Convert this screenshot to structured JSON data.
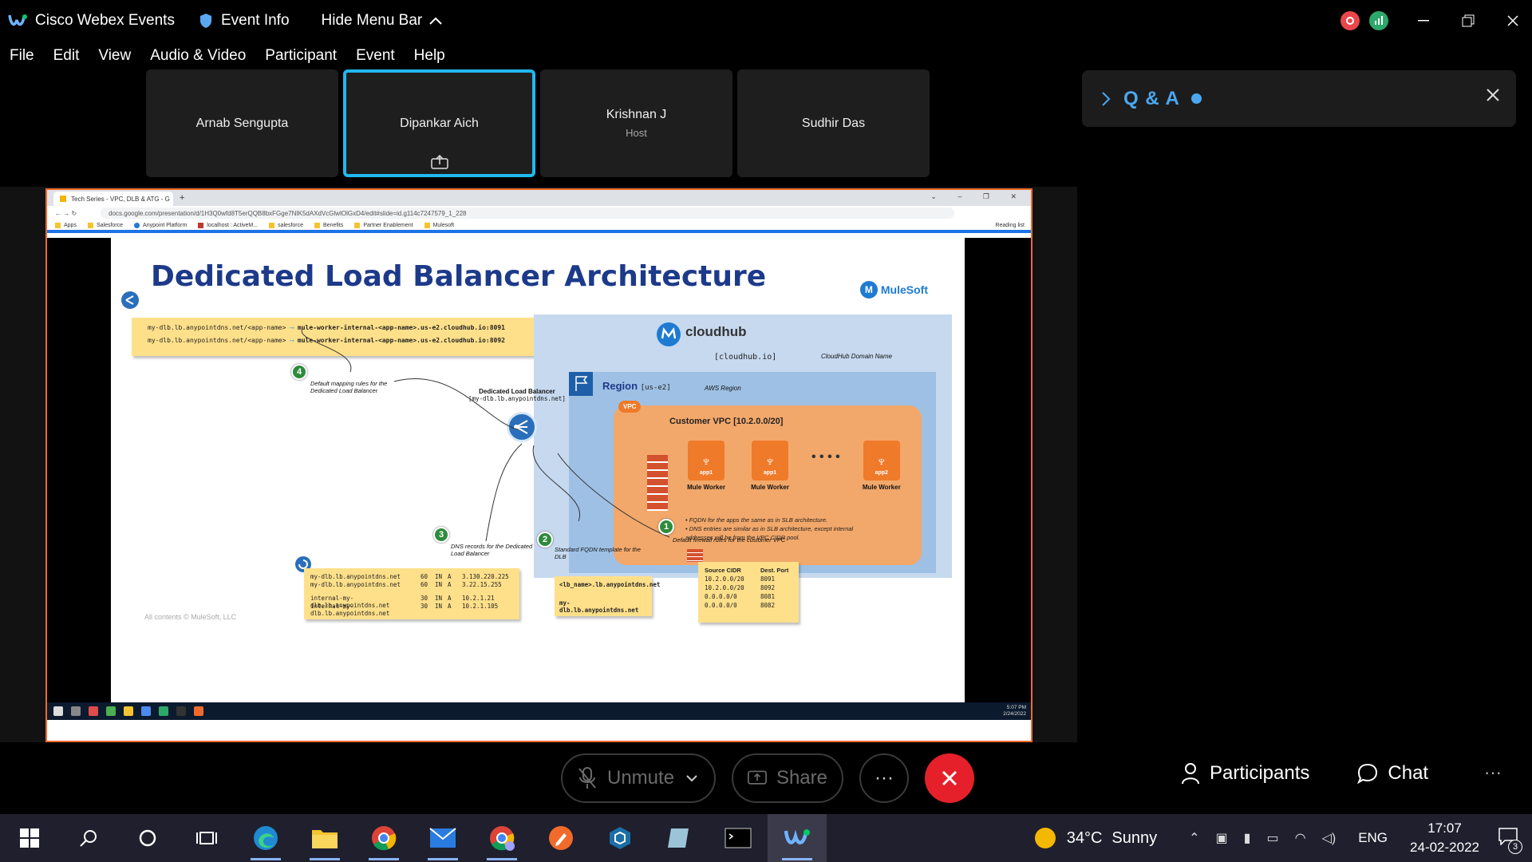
{
  "titlebar": {
    "app_title": "Cisco Webex Events",
    "event_info": "Event Info",
    "hide_menu": "Hide Menu Bar"
  },
  "menu": [
    "File",
    "Edit",
    "View",
    "Audio & Video",
    "Participant",
    "Event",
    "Help"
  ],
  "participants": [
    {
      "name": "Arnab Sengupta",
      "role": ""
    },
    {
      "name": "Dipankar Aich",
      "role": ""
    },
    {
      "name": "Krishnan J",
      "role": "Host"
    },
    {
      "name": "Sudhir Das",
      "role": ""
    }
  ],
  "qa": {
    "title": "Q & A"
  },
  "browser": {
    "tab_title": "Tech Series - VPC, DLB & ATG - G",
    "url": "docs.google.com/presentation/d/1H3Q0wfd8T5erQQB8bxFGge7NIK5dAXdVcGlwlOlGxD4/edit#slide=id.g114c7247579_1_228",
    "bookmarks": [
      "Apps",
      "Salesforce",
      "Anypoint Platform",
      "localhost : ActiveM...",
      "salesforce",
      "Benefits",
      "Partner Enablement",
      "Mulesoft"
    ],
    "reading_list": "Reading list"
  },
  "slide": {
    "title": "Dedicated Load Balancer Architecture",
    "brand": "MuleSoft",
    "mapping": [
      {
        "left": "my-dlb.lb.anypointdns.net/<app-name>",
        "right": "mule-worker-internal-<app-name>.us-e2.cloudhub.io:8091"
      },
      {
        "left": "my-dlb.lb.anypointdns.net/<app-name>",
        "right": "mule-worker-internal-<app-name>.us-e2.cloudhub.io:8092"
      }
    ],
    "cloudhub": "cloudhub",
    "cloudhub_domain": "[cloudhub.io]",
    "cloudhub_domain_label": "CloudHub Domain Name",
    "region": "Region",
    "region_code": "[us-e2]",
    "aws_region": "AWS Region",
    "vpc_badge": "VPC",
    "vpc_title": "Customer VPC [10.2.0.0/20]",
    "workers": [
      {
        "app": "app1",
        "label": "Mule Worker"
      },
      {
        "app": "app1",
        "label": "Mule Worker"
      },
      {
        "app": "app2",
        "label": "Mule Worker"
      }
    ],
    "vpc_bullet_1": "FQDN for the apps the same as in SLB architecture.",
    "vpc_bullet_2": "DNS entries are similar as in SLB architecture, except internal addresses will be from the VPC CIDR pool.",
    "dlb_label": "Dedicated Load Balancer",
    "dlb_host": "[my-dlb.lb.anypointdns.net]",
    "callouts": {
      "c4": "Default mapping rules for the Dedicated Load Balancer",
      "c3": "DNS records for the Dedicated Load Balancer",
      "c2": "Standard FQDN template for the DLB",
      "c1": "Default firewall rules for the customer VPC"
    },
    "dns_records": [
      [
        "my-dlb.lb.anypointdns.net",
        "60",
        "IN",
        "A",
        "3.130.220.225"
      ],
      [
        "my-dlb.lb.anypointdns.net",
        "60",
        "IN",
        "A",
        "3.22.15.255"
      ],
      [
        "internal-my-dlb.lb.anypointdns.net",
        "30",
        "IN",
        "A",
        "10.2.1.21"
      ],
      [
        "internal-my-dlb.lb.anypointdns.net",
        "30",
        "IN",
        "A",
        "10.2.1.105"
      ]
    ],
    "fqdn_template": "<lb_name>.lb.anypointdns.net",
    "fqdn_example": "my-dlb.lb.anypointdns.net",
    "fw_header": [
      "Source CIDR",
      "Dest. Port"
    ],
    "fw_rows": [
      [
        "10.2.0.0/20",
        "8091"
      ],
      [
        "10.2.0.0/20",
        "8092"
      ],
      [
        "0.0.0.0/0",
        "8081"
      ],
      [
        "0.0.0.0/0",
        "8082"
      ]
    ],
    "copyright": "All contents © MuleSoft, LLC",
    "mini_time": "5:07 PM",
    "mini_date": "2/24/2022"
  },
  "controls": {
    "unmute": "Unmute",
    "share": "Share",
    "more": "···",
    "participants": "Participants",
    "chat": "Chat",
    "overflow": "···"
  },
  "taskbar": {
    "temperature": "34°C",
    "weather": "Sunny",
    "language": "ENG",
    "time": "17:07",
    "date": "24-02-2022",
    "notifications": "3"
  },
  "colors": {
    "accent": "#20b8f0",
    "leave": "#e5202a",
    "share_border": "#ef6a2b",
    "qa": "#4aa8f0"
  }
}
